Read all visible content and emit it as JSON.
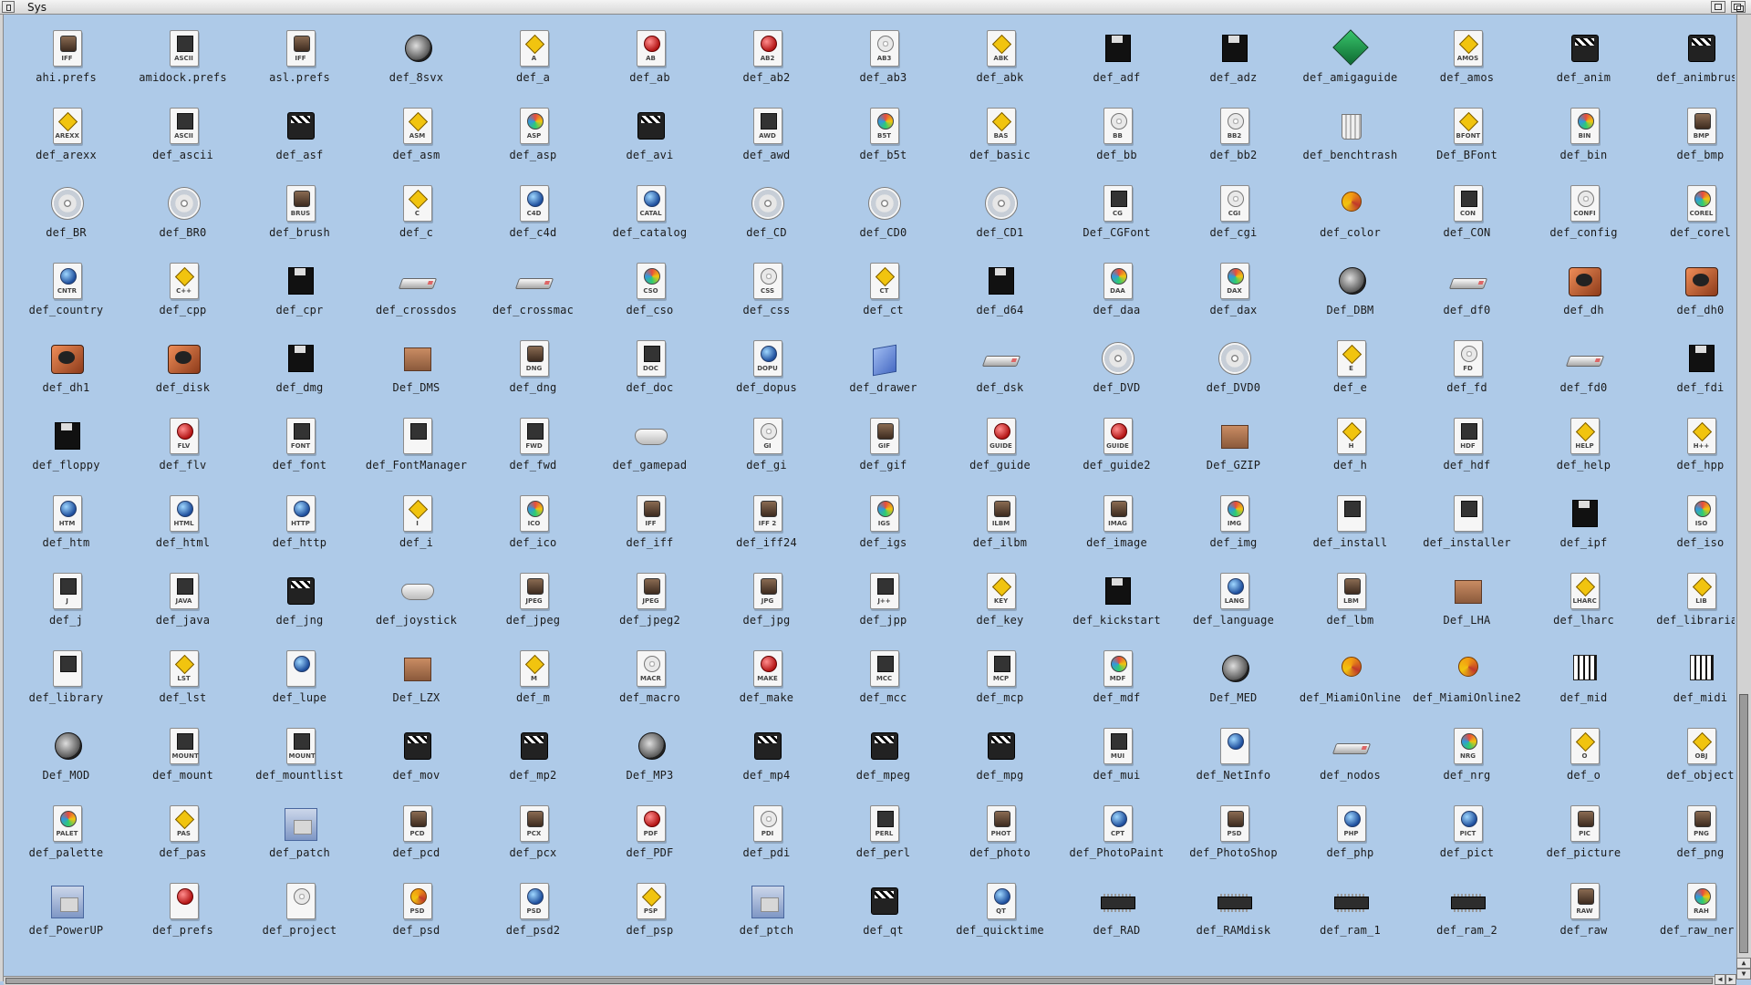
{
  "window": {
    "title": "Sys"
  },
  "icons": [
    {
      "label": "ahi.prefs",
      "type": "page",
      "badge": "face",
      "tag": "IFF"
    },
    {
      "label": "amidock.prefs",
      "type": "page",
      "badge": "dark",
      "tag": "ASCII"
    },
    {
      "label": "asl.prefs",
      "type": "page",
      "badge": "face",
      "tag": "IFF"
    },
    {
      "label": "def_8svx",
      "type": "speaker"
    },
    {
      "label": "def_a",
      "type": "page",
      "badge": "yellow",
      "tag": "A"
    },
    {
      "label": "def_ab",
      "type": "page",
      "badge": "red",
      "tag": "AB"
    },
    {
      "label": "def_ab2",
      "type": "page",
      "badge": "red",
      "tag": "AB2"
    },
    {
      "label": "def_ab3",
      "type": "page",
      "badge": "disc",
      "tag": "AB3"
    },
    {
      "label": "def_abk",
      "type": "page",
      "badge": "yellow",
      "tag": "ABK"
    },
    {
      "label": "def_adf",
      "type": "floppy"
    },
    {
      "label": "def_adz",
      "type": "floppy"
    },
    {
      "label": "def_amigaguide",
      "type": "green"
    },
    {
      "label": "def_amos",
      "type": "page",
      "badge": "yellow",
      "tag": "AMOS"
    },
    {
      "label": "def_anim",
      "type": "clap"
    },
    {
      "label": "def_animbrush",
      "type": "clap"
    },
    {
      "label": "def_arexx",
      "type": "page",
      "badge": "yellow",
      "tag": "AREXX"
    },
    {
      "label": "def_ascii",
      "type": "page",
      "badge": "dark",
      "tag": "ASCII"
    },
    {
      "label": "def_asf",
      "type": "clap"
    },
    {
      "label": "def_asm",
      "type": "page",
      "badge": "yellow",
      "tag": "ASM"
    },
    {
      "label": "def_asp",
      "type": "page",
      "badge": "multi",
      "tag": "ASP"
    },
    {
      "label": "def_avi",
      "type": "clap"
    },
    {
      "label": "def_awd",
      "type": "page",
      "badge": "dark",
      "tag": "AWD"
    },
    {
      "label": "def_b5t",
      "type": "page",
      "badge": "multi",
      "tag": "B5T"
    },
    {
      "label": "def_basic",
      "type": "page",
      "badge": "yellow",
      "tag": "BAS"
    },
    {
      "label": "def_bb",
      "type": "page",
      "badge": "disc",
      "tag": "BB"
    },
    {
      "label": "def_bb2",
      "type": "page",
      "badge": "disc",
      "tag": "BB2"
    },
    {
      "label": "def_benchtrash",
      "type": "trash"
    },
    {
      "label": "Def_BFont",
      "type": "page",
      "badge": "yellow",
      "tag": "BFONT"
    },
    {
      "label": "def_bin",
      "type": "page",
      "badge": "multi",
      "tag": "BIN"
    },
    {
      "label": "def_bmp",
      "type": "page",
      "badge": "face",
      "tag": "BMP"
    },
    {
      "label": "def_BR",
      "type": "cd"
    },
    {
      "label": "def_BR0",
      "type": "cd"
    },
    {
      "label": "def_brush",
      "type": "page",
      "badge": "face",
      "tag": "BRUS"
    },
    {
      "label": "def_c",
      "type": "page",
      "badge": "yellow",
      "tag": "C"
    },
    {
      "label": "def_c4d",
      "type": "page",
      "badge": "globe",
      "tag": "C4D"
    },
    {
      "label": "def_catalog",
      "type": "page",
      "badge": "globe",
      "tag": "CATAL"
    },
    {
      "label": "def_CD",
      "type": "cd"
    },
    {
      "label": "def_CD0",
      "type": "cd"
    },
    {
      "label": "def_CD1",
      "type": "cd"
    },
    {
      "label": "Def_CGFont",
      "type": "page",
      "badge": "dark",
      "tag": "CG"
    },
    {
      "label": "def_cgi",
      "type": "page",
      "badge": "disc",
      "tag": "CGI"
    },
    {
      "label": "def_color",
      "type": "swirl"
    },
    {
      "label": "def_CON",
      "type": "page",
      "badge": "dark",
      "tag": "CON"
    },
    {
      "label": "def_config",
      "type": "page",
      "badge": "disc",
      "tag": "CONFI"
    },
    {
      "label": "def_corel",
      "type": "page",
      "badge": "multi",
      "tag": "COREL"
    },
    {
      "label": "def_country",
      "type": "page",
      "badge": "globe",
      "tag": "CNTR"
    },
    {
      "label": "def_cpp",
      "type": "page",
      "badge": "yellow",
      "tag": "C++"
    },
    {
      "label": "def_cpr",
      "type": "floppy"
    },
    {
      "label": "def_crossdos",
      "type": "usb"
    },
    {
      "label": "def_crossmac",
      "type": "usb"
    },
    {
      "label": "def_cso",
      "type": "page",
      "badge": "multi",
      "tag": "CSO"
    },
    {
      "label": "def_css",
      "type": "page",
      "badge": "disc",
      "tag": "CSS"
    },
    {
      "label": "def_ct",
      "type": "page",
      "badge": "yellow",
      "tag": "CT"
    },
    {
      "label": "def_d64",
      "type": "floppy"
    },
    {
      "label": "def_daa",
      "type": "page",
      "badge": "multi",
      "tag": "DAA"
    },
    {
      "label": "def_dax",
      "type": "page",
      "badge": "multi",
      "tag": "DAX"
    },
    {
      "label": "Def_DBM",
      "type": "speaker"
    },
    {
      "label": "def_df0",
      "type": "usb"
    },
    {
      "label": "def_dh",
      "type": "hd"
    },
    {
      "label": "def_dh0",
      "type": "hd"
    },
    {
      "label": "def_dh1",
      "type": "hd"
    },
    {
      "label": "def_disk",
      "type": "hd"
    },
    {
      "label": "def_dmg",
      "type": "floppy"
    },
    {
      "label": "Def_DMS",
      "type": "box"
    },
    {
      "label": "def_dng",
      "type": "page",
      "badge": "face",
      "tag": "DNG"
    },
    {
      "label": "def_doc",
      "type": "page",
      "badge": "dark",
      "tag": "DOC"
    },
    {
      "label": "def_dopus",
      "type": "page",
      "badge": "globe",
      "tag": "DOPU"
    },
    {
      "label": "def_drawer",
      "type": "folder"
    },
    {
      "label": "def_dsk",
      "type": "usb"
    },
    {
      "label": "def_DVD",
      "type": "cd"
    },
    {
      "label": "def_DVD0",
      "type": "cd"
    },
    {
      "label": "def_e",
      "type": "page",
      "badge": "yellow",
      "tag": "E"
    },
    {
      "label": "def_fd",
      "type": "page",
      "badge": "disc",
      "tag": "FD"
    },
    {
      "label": "def_fd0",
      "type": "usb"
    },
    {
      "label": "def_fdi",
      "type": "floppy"
    },
    {
      "label": "def_floppy",
      "type": "floppy"
    },
    {
      "label": "def_flv",
      "type": "page",
      "badge": "red",
      "tag": "FLV"
    },
    {
      "label": "def_font",
      "type": "page",
      "badge": "dark",
      "tag": "FONT"
    },
    {
      "label": "def_FontManager",
      "type": "page",
      "badge": "dark",
      "tag": ""
    },
    {
      "label": "def_fwd",
      "type": "page",
      "badge": "dark",
      "tag": "FWD"
    },
    {
      "label": "def_gamepad",
      "type": "gamepad"
    },
    {
      "label": "def_gi",
      "type": "page",
      "badge": "disc",
      "tag": "GI"
    },
    {
      "label": "def_gif",
      "type": "page",
      "badge": "face",
      "tag": "GIF"
    },
    {
      "label": "def_guide",
      "type": "page",
      "badge": "red",
      "tag": "GUIDE"
    },
    {
      "label": "def_guide2",
      "type": "page",
      "badge": "red",
      "tag": "GUIDE"
    },
    {
      "label": "Def_GZIP",
      "type": "box"
    },
    {
      "label": "def_h",
      "type": "page",
      "badge": "yellow",
      "tag": "H"
    },
    {
      "label": "def_hdf",
      "type": "page",
      "badge": "dark",
      "tag": "HDF"
    },
    {
      "label": "def_help",
      "type": "page",
      "badge": "yellow",
      "tag": "HELP"
    },
    {
      "label": "def_hpp",
      "type": "page",
      "badge": "yellow",
      "tag": "H++"
    },
    {
      "label": "def_htm",
      "type": "page",
      "badge": "globe",
      "tag": "HTM"
    },
    {
      "label": "def_html",
      "type": "page",
      "badge": "globe",
      "tag": "HTML"
    },
    {
      "label": "def_http",
      "type": "page",
      "badge": "globe",
      "tag": "HTTP"
    },
    {
      "label": "def_i",
      "type": "page",
      "badge": "yellow",
      "tag": "I"
    },
    {
      "label": "def_ico",
      "type": "page",
      "badge": "multi",
      "tag": "ICO"
    },
    {
      "label": "def_iff",
      "type": "page",
      "badge": "face",
      "tag": "IFF"
    },
    {
      "label": "def_iff24",
      "type": "page",
      "badge": "face",
      "tag": "IFF 2"
    },
    {
      "label": "def_igs",
      "type": "page",
      "badge": "multi",
      "tag": "IGS"
    },
    {
      "label": "def_ilbm",
      "type": "page",
      "badge": "face",
      "tag": "ILBM"
    },
    {
      "label": "def_image",
      "type": "page",
      "badge": "face",
      "tag": "IMAG"
    },
    {
      "label": "def_img",
      "type": "page",
      "badge": "multi",
      "tag": "IMG"
    },
    {
      "label": "def_install",
      "type": "page",
      "badge": "dark",
      "tag": ""
    },
    {
      "label": "def_installer",
      "type": "page",
      "badge": "dark",
      "tag": ""
    },
    {
      "label": "def_ipf",
      "type": "floppy"
    },
    {
      "label": "def_iso",
      "type": "page",
      "badge": "multi",
      "tag": "ISO"
    },
    {
      "label": "def_j",
      "type": "page",
      "badge": "dark",
      "tag": "J"
    },
    {
      "label": "def_java",
      "type": "page",
      "badge": "dark",
      "tag": "JAVA"
    },
    {
      "label": "def_jng",
      "type": "clap"
    },
    {
      "label": "def_joystick",
      "type": "gamepad"
    },
    {
      "label": "def_jpeg",
      "type": "page",
      "badge": "face",
      "tag": "JPEG"
    },
    {
      "label": "def_jpeg2",
      "type": "page",
      "badge": "face",
      "tag": "JPEG"
    },
    {
      "label": "def_jpg",
      "type": "page",
      "badge": "face",
      "tag": "JPG"
    },
    {
      "label": "def_jpp",
      "type": "page",
      "badge": "dark",
      "tag": "J++"
    },
    {
      "label": "def_key",
      "type": "page",
      "badge": "yellow",
      "tag": "KEY"
    },
    {
      "label": "def_kickstart",
      "type": "floppy"
    },
    {
      "label": "def_language",
      "type": "page",
      "badge": "globe",
      "tag": "LANG"
    },
    {
      "label": "def_lbm",
      "type": "page",
      "badge": "face",
      "tag": "LBM"
    },
    {
      "label": "Def_LHA",
      "type": "box"
    },
    {
      "label": "def_lharc",
      "type": "page",
      "badge": "yellow",
      "tag": "LHARC"
    },
    {
      "label": "def_librarian",
      "type": "page",
      "badge": "yellow",
      "tag": "LIB"
    },
    {
      "label": "def_library",
      "type": "page",
      "badge": "dark",
      "tag": ""
    },
    {
      "label": "def_lst",
      "type": "page",
      "badge": "yellow",
      "tag": "LST"
    },
    {
      "label": "def_lupe",
      "type": "page",
      "badge": "globe",
      "tag": ""
    },
    {
      "label": "Def_LZX",
      "type": "box"
    },
    {
      "label": "def_m",
      "type": "page",
      "badge": "yellow",
      "tag": "M"
    },
    {
      "label": "def_macro",
      "type": "page",
      "badge": "disc",
      "tag": "MACR"
    },
    {
      "label": "def_make",
      "type": "page",
      "badge": "red",
      "tag": "MAKE"
    },
    {
      "label": "def_mcc",
      "type": "page",
      "badge": "dark",
      "tag": "MCC"
    },
    {
      "label": "def_mcp",
      "type": "page",
      "badge": "dark",
      "tag": "MCP"
    },
    {
      "label": "def_mdf",
      "type": "page",
      "badge": "multi",
      "tag": "MDF"
    },
    {
      "label": "Def_MED",
      "type": "speaker"
    },
    {
      "label": "def_MiamiOnline",
      "type": "swirl"
    },
    {
      "label": "def_MiamiOnline2",
      "type": "swirl"
    },
    {
      "label": "def_mid",
      "type": "bars"
    },
    {
      "label": "def_midi",
      "type": "bars"
    },
    {
      "label": "Def_MOD",
      "type": "speaker"
    },
    {
      "label": "def_mount",
      "type": "page",
      "badge": "dark",
      "tag": "MOUNT"
    },
    {
      "label": "def_mountlist",
      "type": "page",
      "badge": "dark",
      "tag": "MOUNT"
    },
    {
      "label": "def_mov",
      "type": "clap"
    },
    {
      "label": "def_mp2",
      "type": "clap"
    },
    {
      "label": "Def_MP3",
      "type": "speaker"
    },
    {
      "label": "def_mp4",
      "type": "clap"
    },
    {
      "label": "def_mpeg",
      "type": "clap"
    },
    {
      "label": "def_mpg",
      "type": "clap"
    },
    {
      "label": "def_mui",
      "type": "page",
      "badge": "dark",
      "tag": "MUI"
    },
    {
      "label": "def_NetInfo",
      "type": "page",
      "badge": "globe",
      "tag": ""
    },
    {
      "label": "def_nodos",
      "type": "usb"
    },
    {
      "label": "def_nrg",
      "type": "page",
      "badge": "multi",
      "tag": "NRG"
    },
    {
      "label": "def_o",
      "type": "page",
      "badge": "yellow",
      "tag": "O"
    },
    {
      "label": "def_object",
      "type": "page",
      "badge": "yellow",
      "tag": "OBJ"
    },
    {
      "label": "def_palette",
      "type": "page",
      "badge": "multi",
      "tag": "PALET"
    },
    {
      "label": "def_pas",
      "type": "page",
      "badge": "yellow",
      "tag": "PAS"
    },
    {
      "label": "def_patch",
      "type": "apprect"
    },
    {
      "label": "def_pcd",
      "type": "page",
      "badge": "face",
      "tag": "PCD"
    },
    {
      "label": "def_pcx",
      "type": "page",
      "badge": "face",
      "tag": "PCX"
    },
    {
      "label": "def_PDF",
      "type": "page",
      "badge": "red",
      "tag": "PDF"
    },
    {
      "label": "def_pdi",
      "type": "page",
      "badge": "disc",
      "tag": "PDI"
    },
    {
      "label": "def_perl",
      "type": "page",
      "badge": "dark",
      "tag": "PERL"
    },
    {
      "label": "def_photo",
      "type": "page",
      "badge": "face",
      "tag": "PHOT"
    },
    {
      "label": "def_PhotoPaint",
      "type": "page",
      "badge": "globe",
      "tag": "CPT"
    },
    {
      "label": "def_PhotoShop",
      "type": "page",
      "badge": "face",
      "tag": "PSD"
    },
    {
      "label": "def_php",
      "type": "page",
      "badge": "globe",
      "tag": "PHP"
    },
    {
      "label": "def_pict",
      "type": "page",
      "badge": "globe",
      "tag": "PICT"
    },
    {
      "label": "def_picture",
      "type": "page",
      "badge": "face",
      "tag": "PIC"
    },
    {
      "label": "def_png",
      "type": "page",
      "badge": "face",
      "tag": "PNG"
    },
    {
      "label": "def_PowerUP",
      "type": "apprect"
    },
    {
      "label": "def_prefs",
      "type": "page",
      "badge": "red",
      "tag": ""
    },
    {
      "label": "def_project",
      "type": "page",
      "badge": "disc",
      "tag": ""
    },
    {
      "label": "def_psd",
      "type": "page",
      "badge": "swirl",
      "tag": "PSD"
    },
    {
      "label": "def_psd2",
      "type": "page",
      "badge": "globe",
      "tag": "PSD"
    },
    {
      "label": "def_psp",
      "type": "page",
      "badge": "yellow",
      "tag": "PSP"
    },
    {
      "label": "def_ptch",
      "type": "apprect"
    },
    {
      "label": "def_qt",
      "type": "clap"
    },
    {
      "label": "def_quicktime",
      "type": "page",
      "badge": "globe",
      "tag": "QT"
    },
    {
      "label": "def_RAD",
      "type": "chip"
    },
    {
      "label": "def_RAMdisk",
      "type": "chip"
    },
    {
      "label": "def_ram_1",
      "type": "chip"
    },
    {
      "label": "def_ram_2",
      "type": "chip"
    },
    {
      "label": "def_raw",
      "type": "page",
      "badge": "face",
      "tag": "RAW"
    },
    {
      "label": "def_raw_nero",
      "type": "page",
      "badge": "multi",
      "tag": "RAH"
    }
  ]
}
